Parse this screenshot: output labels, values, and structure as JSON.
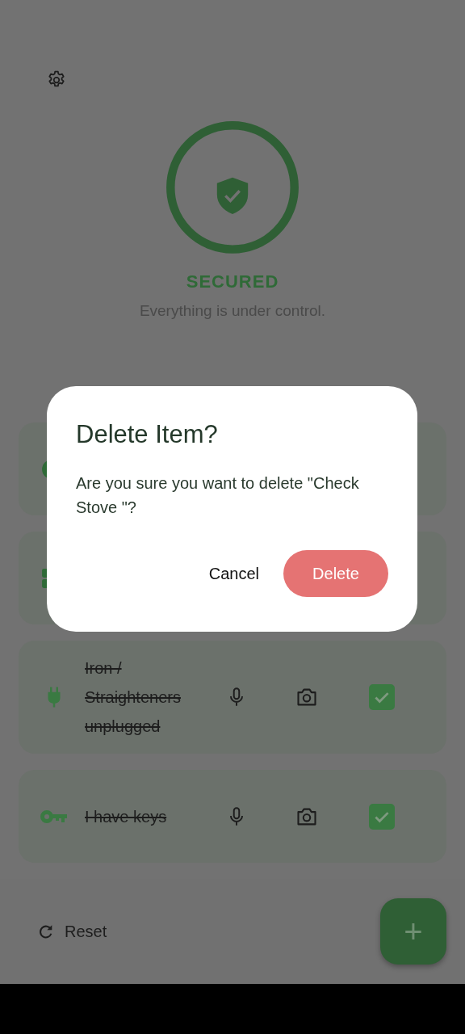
{
  "status": {
    "title": "SECURED",
    "subtitle": "Everything is under control."
  },
  "items": [
    {
      "label": "Iron / Straighteners unplugged",
      "checked": true
    },
    {
      "label": "I have keys",
      "checked": true
    }
  ],
  "reset": {
    "label": "Reset"
  },
  "fab": {
    "label": "+"
  },
  "dialog": {
    "title": "Delete Item?",
    "message": "Are you sure you want to delete \"Check Stove \"?",
    "buttons": [
      {
        "kind": "text",
        "label": "Cancel"
      },
      {
        "kind": "danger",
        "label": "Delete"
      }
    ]
  }
}
